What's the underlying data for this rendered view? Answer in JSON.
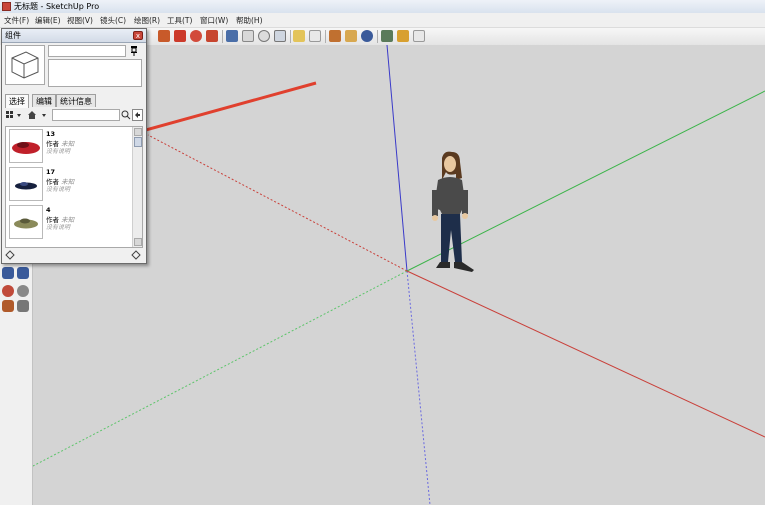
{
  "window": {
    "title": "无标题 - SketchUp Pro"
  },
  "menu": [
    {
      "label": "文件(F)"
    },
    {
      "label": "编辑(E)"
    },
    {
      "label": "视图(V)"
    },
    {
      "label": "镜头(C)"
    },
    {
      "label": "绘图(R)"
    },
    {
      "label": "工具(T)"
    },
    {
      "label": "窗口(W)"
    },
    {
      "label": "帮助(H)"
    }
  ],
  "panel": {
    "title": "组件",
    "close_label": "x",
    "tabs": [
      {
        "label": "选择"
      },
      {
        "label": "编辑"
      },
      {
        "label": "统计信息"
      }
    ],
    "search_placeholder": "",
    "items": [
      {
        "name": "13",
        "author_label": "作者",
        "author_value": "未知",
        "description": "没有说明",
        "thumb": "red-car"
      },
      {
        "name": "17",
        "author_label": "作者",
        "author_value": "未知",
        "description": "没有说明",
        "thumb": "dark-blue-car"
      },
      {
        "name": "4",
        "author_label": "作者",
        "author_value": "未知",
        "description": "没有说明",
        "thumb": "olive-car"
      }
    ]
  },
  "colors": {
    "axis_red": "#c9403a",
    "axis_green": "#3cb44a",
    "axis_blue": "#3a3ac9",
    "annotation_arrow": "#e0402e",
    "viewport_bg": "#d4d4d4"
  },
  "icons": [
    "select-icon",
    "eraser-icon",
    "paint-icon",
    "line-icon",
    "arc-icon",
    "rectangle-icon",
    "circle-icon",
    "pushpull-icon",
    "move-icon",
    "rotate-icon",
    "offset-icon",
    "orbit-icon",
    "pan-icon",
    "zoom-icon",
    "zoom-extents-icon",
    "tape-icon",
    "text-icon",
    "walk-icon",
    "lookaround-icon",
    "position-camera-icon",
    "section-plane-icon",
    "components-icon",
    "warehouse-icon",
    "extension-icon",
    "layout-icon"
  ]
}
